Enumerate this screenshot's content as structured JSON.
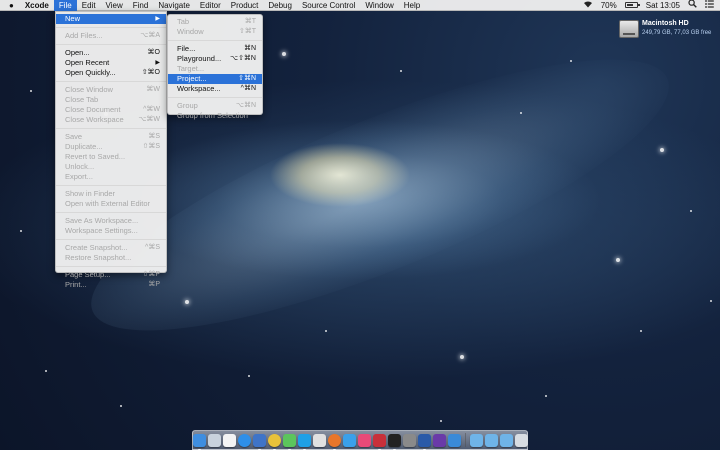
{
  "menubar": {
    "apple_icon": "apple-icon",
    "app_name": "Xcode",
    "menus": [
      "File",
      "Edit",
      "View",
      "Find",
      "Navigate",
      "Editor",
      "Product",
      "Debug",
      "Source Control",
      "Window",
      "Help"
    ],
    "status": {
      "wifi_icon": "wifi-icon",
      "battery_percent": 70,
      "battery_text": "70%",
      "clock": "Sat 13:05",
      "search_icon": "spotlight-icon",
      "notifications_icon": "notification-center-icon"
    }
  },
  "file_menu": {
    "new": "New",
    "add_files": "Add Files...",
    "add_files_sc": "⌥⌘A",
    "open": "Open...",
    "open_sc": "⌘O",
    "open_recent": "Open Recent",
    "open_quickly": "Open Quickly...",
    "open_quickly_sc": "⇧⌘O",
    "close_window": "Close Window",
    "close_window_sc": "⌘W",
    "close_tab": "Close Tab",
    "close_document": "Close Document",
    "close_document_sc": "^⌘W",
    "close_workspace": "Close Workspace",
    "close_workspace_sc": "⌥⌘W",
    "save": "Save",
    "save_sc": "⌘S",
    "duplicate": "Duplicate...",
    "duplicate_sc": "⇧⌘S",
    "revert": "Revert to Saved...",
    "unlock": "Unlock...",
    "export": "Export...",
    "show_in_finder": "Show in Finder",
    "open_external": "Open with External Editor",
    "save_as_workspace": "Save As Workspace...",
    "workspace_settings": "Workspace Settings...",
    "create_snapshot": "Create Snapshot...",
    "create_snapshot_sc": "^⌘S",
    "restore_snapshot": "Restore Snapshot...",
    "page_setup": "Page Setup...",
    "page_setup_sc": "⇧⌘P",
    "print": "Print...",
    "print_sc": "⌘P"
  },
  "new_menu": {
    "tab": "Tab",
    "tab_sc": "⌘T",
    "window": "Window",
    "window_sc": "⇧⌘T",
    "file": "File...",
    "file_sc": "⌘N",
    "playground": "Playground...",
    "playground_sc": "⌥⇧⌘N",
    "target": "Target...",
    "project": "Project...",
    "project_sc": "⇧⌘N",
    "workspace": "Workspace...",
    "workspace_sc": "^⌘N",
    "group": "Group",
    "group_sc": "⌥⌘N",
    "group_from_selection": "Group from Selection"
  },
  "desktop": {
    "disk_name": "Macintosh HD",
    "disk_info": "249,79 GB, 77,03 GB free"
  },
  "dock": {
    "apps": [
      {
        "name": "finder-icon",
        "color": "#3f8ee0"
      },
      {
        "name": "launchpad-icon",
        "color": "#c9d2dc"
      },
      {
        "name": "calendar-icon",
        "color": "#f4f4f4"
      },
      {
        "name": "safari-icon",
        "color": "#2e8fe8"
      },
      {
        "name": "xcode-icon",
        "color": "#3f74c8"
      },
      {
        "name": "chrome-icon",
        "color": "#e8c23a"
      },
      {
        "name": "messages-icon",
        "color": "#5cc55c"
      },
      {
        "name": "skype-icon",
        "color": "#1ea0e6"
      },
      {
        "name": "app-icon",
        "color": "#e0e0e0"
      },
      {
        "name": "firefox-icon",
        "color": "#e8762a"
      },
      {
        "name": "app-store-icon",
        "color": "#3aa0ea"
      },
      {
        "name": "itunes-icon",
        "color": "#e84a78"
      },
      {
        "name": "photo-booth-icon",
        "color": "#c8303a"
      },
      {
        "name": "terminal-icon",
        "color": "#222222"
      },
      {
        "name": "system-preferences-icon",
        "color": "#8a8a8a"
      },
      {
        "name": "word-icon",
        "color": "#2a5aa8"
      },
      {
        "name": "vs-icon",
        "color": "#6a3aa8"
      },
      {
        "name": "xcode-tools-icon",
        "color": "#3a8ad8"
      }
    ],
    "stacks": [
      {
        "name": "downloads-folder-icon",
        "color": "#6fb4e8"
      },
      {
        "name": "applications-folder-icon",
        "color": "#6fb4e8"
      },
      {
        "name": "documents-folder-icon",
        "color": "#6fb4e8"
      },
      {
        "name": "trash-icon",
        "color": "#d8dde2"
      }
    ]
  }
}
